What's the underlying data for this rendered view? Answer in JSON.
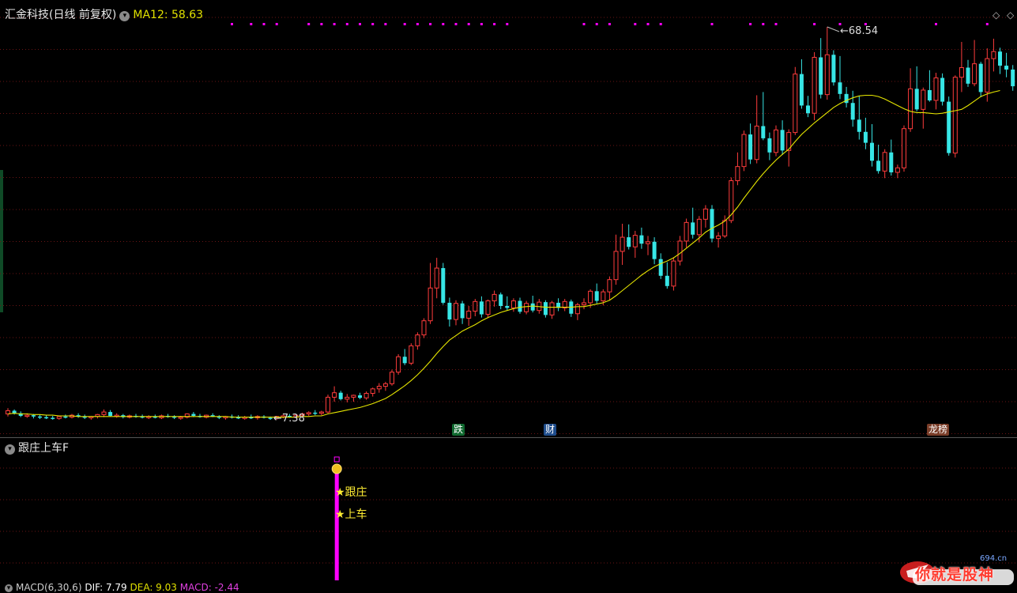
{
  "header": {
    "stock_name": "汇金科技",
    "period_label": "(日线 前复权)",
    "ma_label": "MA12: 58.63"
  },
  "sub_panel": {
    "title": "跟庄上车F"
  },
  "signals": {
    "line1": "★跟庄",
    "line2": "★上车"
  },
  "macd_panel": {
    "params": "MACD(6,30,6)",
    "dif": "DIF: 7.79",
    "dea": "DEA: 9.03",
    "macd": "MACD: -2.44"
  },
  "badges": {
    "die": "跌",
    "cai": "财",
    "bang": "龙榜"
  },
  "price_labels": {
    "high": "68.54",
    "low": "7.38",
    "high_arrow": "←",
    "low_arrow": "←"
  },
  "watermark": {
    "text": "你就是股神",
    "site": "694.cn"
  },
  "colors": {
    "up": "#ff3c3c",
    "down": "#37e6e6",
    "ma": "#e6e600",
    "signal": "#ff00ff",
    "dots": "#ff00ff"
  },
  "chart_data": {
    "type": "candlestick",
    "title": "汇金科技(日线 前复权)",
    "y_min_label": 7.38,
    "y_max_label": 68.54,
    "ylim": [
      0,
      72
    ],
    "grid": true,
    "candles": [
      [
        8.3,
        9.2,
        7.9,
        8.8
      ],
      [
        8.8,
        9.0,
        8.2,
        8.4
      ],
      [
        8.4,
        8.7,
        7.8,
        8.0
      ],
      [
        8.0,
        8.4,
        7.7,
        8.1
      ],
      [
        8.1,
        8.3,
        7.6,
        7.9
      ],
      [
        7.9,
        8.2,
        7.5,
        7.8
      ],
      [
        7.8,
        8.1,
        7.5,
        7.7
      ],
      [
        7.7,
        8.0,
        7.4,
        7.6
      ],
      [
        7.6,
        8.0,
        7.4,
        7.9
      ],
      [
        7.9,
        8.2,
        7.6,
        7.8
      ],
      [
        7.8,
        8.3,
        7.6,
        8.1
      ],
      [
        8.1,
        8.4,
        7.7,
        7.9
      ],
      [
        7.9,
        8.2,
        7.5,
        7.7
      ],
      [
        7.7,
        8.0,
        7.4,
        7.9
      ],
      [
        7.9,
        8.3,
        7.6,
        8.2
      ],
      [
        8.2,
        9.0,
        7.8,
        8.6
      ],
      [
        8.6,
        8.9,
        7.9,
        8.0
      ],
      [
        8.0,
        8.4,
        7.7,
        8.1
      ],
      [
        8.1,
        8.3,
        7.6,
        7.8
      ],
      [
        7.8,
        8.2,
        7.6,
        8.0
      ],
      [
        8.0,
        8.3,
        7.7,
        7.9
      ],
      [
        7.9,
        8.2,
        7.6,
        7.8
      ],
      [
        7.8,
        8.1,
        7.5,
        7.9
      ],
      [
        7.9,
        8.2,
        7.6,
        7.7
      ],
      [
        7.7,
        8.2,
        7.5,
        8.0
      ],
      [
        8.0,
        8.3,
        7.7,
        7.9
      ],
      [
        7.9,
        8.1,
        7.5,
        7.7
      ],
      [
        7.7,
        8.0,
        7.4,
        7.8
      ],
      [
        7.8,
        8.4,
        7.6,
        8.3
      ],
      [
        8.3,
        8.6,
        7.8,
        8.0
      ],
      [
        8.0,
        8.3,
        7.7,
        7.8
      ],
      [
        7.8,
        8.2,
        7.6,
        8.1
      ],
      [
        8.1,
        8.4,
        7.8,
        7.9
      ],
      [
        7.9,
        8.1,
        7.5,
        7.7
      ],
      [
        7.7,
        8.0,
        7.4,
        7.9
      ],
      [
        7.9,
        8.2,
        7.6,
        7.8
      ],
      [
        7.8,
        8.1,
        7.5,
        7.6
      ],
      [
        7.6,
        8.0,
        7.4,
        7.8
      ],
      [
        7.8,
        8.2,
        7.5,
        7.7
      ],
      [
        7.7,
        8.1,
        7.4,
        7.9
      ],
      [
        7.9,
        8.1,
        7.6,
        7.7
      ],
      [
        7.7,
        7.9,
        7.38,
        7.6
      ],
      [
        7.6,
        8.0,
        7.4,
        7.9
      ],
      [
        7.9,
        8.2,
        7.6,
        8.0
      ],
      [
        8.0,
        8.3,
        7.7,
        7.8
      ],
      [
        7.8,
        8.3,
        7.6,
        8.1
      ],
      [
        8.1,
        8.5,
        7.8,
        8.3
      ],
      [
        8.3,
        8.7,
        8.0,
        8.5
      ],
      [
        8.5,
        8.9,
        8.1,
        8.4
      ],
      [
        8.4,
        8.8,
        8.1,
        8.6
      ],
      [
        8.6,
        11.3,
        8.4,
        10.9
      ],
      [
        10.9,
        12.6,
        10.2,
        11.6
      ],
      [
        11.6,
        11.9,
        10.4,
        10.6
      ],
      [
        10.6,
        11.4,
        10.1,
        10.9
      ],
      [
        10.9,
        11.3,
        10.2,
        11.2
      ],
      [
        11.2,
        11.6,
        10.6,
        10.8
      ],
      [
        10.8,
        11.8,
        10.5,
        11.5
      ],
      [
        11.5,
        12.4,
        11.0,
        12.2
      ],
      [
        12.2,
        13.1,
        11.6,
        12.6
      ],
      [
        12.6,
        13.3,
        11.9,
        13.0
      ],
      [
        13.0,
        15.2,
        12.7,
        14.8
      ],
      [
        14.8,
        17.6,
        14.4,
        17.2
      ],
      [
        17.2,
        18.4,
        15.9,
        16.2
      ],
      [
        16.2,
        19.3,
        15.9,
        18.9
      ],
      [
        18.9,
        21.0,
        18.3,
        20.6
      ],
      [
        20.6,
        23.2,
        20.1,
        22.8
      ],
      [
        22.8,
        31.8,
        22.3,
        27.9
      ],
      [
        27.9,
        32.6,
        26.3,
        31.0
      ],
      [
        31.0,
        31.8,
        25.3,
        25.6
      ],
      [
        25.6,
        26.4,
        21.9,
        23.0
      ],
      [
        23.0,
        26.0,
        22.1,
        25.5
      ],
      [
        25.5,
        25.9,
        22.3,
        23.2
      ],
      [
        23.2,
        25.1,
        22.0,
        24.3
      ],
      [
        24.3,
        26.2,
        23.5,
        25.8
      ],
      [
        25.8,
        26.6,
        23.3,
        23.8
      ],
      [
        23.8,
        26.1,
        23.2,
        25.9
      ],
      [
        25.9,
        27.5,
        25.0,
        26.9
      ],
      [
        26.9,
        27.2,
        24.6,
        25.1
      ],
      [
        25.1,
        26.6,
        24.4,
        24.8
      ],
      [
        24.8,
        26.3,
        24.2,
        25.9
      ],
      [
        25.9,
        26.4,
        23.9,
        24.2
      ],
      [
        24.2,
        25.9,
        23.8,
        25.5
      ],
      [
        25.5,
        26.7,
        24.1,
        24.4
      ],
      [
        24.4,
        26.2,
        23.9,
        25.7
      ],
      [
        25.7,
        26.0,
        23.3,
        23.7
      ],
      [
        23.7,
        25.9,
        23.1,
        25.6
      ],
      [
        25.6,
        26.3,
        24.3,
        24.8
      ],
      [
        24.8,
        26.2,
        24.3,
        25.8
      ],
      [
        25.8,
        26.1,
        23.4,
        23.9
      ],
      [
        23.9,
        25.6,
        22.9,
        25.3
      ],
      [
        25.3,
        26.3,
        24.6,
        25.6
      ],
      [
        25.6,
        27.7,
        24.8,
        27.4
      ],
      [
        27.4,
        28.6,
        25.5,
        25.9
      ],
      [
        25.9,
        27.7,
        25.2,
        27.3
      ],
      [
        27.3,
        29.7,
        26.0,
        29.2
      ],
      [
        29.2,
        36.2,
        28.4,
        33.6
      ],
      [
        33.6,
        37.9,
        31.5,
        35.8
      ],
      [
        35.8,
        37.8,
        33.9,
        34.3
      ],
      [
        34.3,
        36.8,
        32.6,
        36.1
      ],
      [
        36.1,
        37.3,
        34.0,
        34.8
      ],
      [
        34.8,
        36.0,
        33.0,
        35.1
      ],
      [
        35.1,
        35.8,
        31.6,
        32.4
      ],
      [
        32.4,
        33.3,
        29.3,
        29.8
      ],
      [
        29.8,
        31.9,
        27.8,
        28.2
      ],
      [
        28.2,
        32.7,
        27.5,
        32.1
      ],
      [
        32.1,
        36.0,
        31.4,
        35.2
      ],
      [
        35.2,
        38.7,
        34.2,
        38.1
      ],
      [
        38.1,
        40.4,
        35.6,
        36.2
      ],
      [
        36.2,
        39.1,
        35.0,
        38.6
      ],
      [
        38.6,
        40.8,
        37.3,
        40.2
      ],
      [
        40.2,
        40.8,
        35.0,
        35.6
      ],
      [
        35.6,
        36.6,
        34.2,
        36.0
      ],
      [
        36.0,
        39.2,
        35.7,
        38.4
      ],
      [
        38.4,
        45.1,
        38.0,
        44.6
      ],
      [
        44.6,
        49.0,
        43.9,
        46.8
      ],
      [
        46.8,
        52.4,
        46.1,
        51.8
      ],
      [
        51.8,
        53.5,
        47.2,
        47.9
      ],
      [
        47.9,
        57.9,
        47.3,
        53.1
      ],
      [
        53.1,
        58.4,
        50.9,
        51.2
      ],
      [
        51.2,
        52.1,
        47.8,
        49.0
      ],
      [
        49.0,
        53.2,
        48.4,
        52.5
      ],
      [
        52.5,
        54.0,
        48.6,
        49.3
      ],
      [
        49.3,
        52.6,
        46.8,
        52.1
      ],
      [
        52.1,
        62.3,
        51.7,
        61.2
      ],
      [
        61.2,
        63.5,
        55.8,
        56.3
      ],
      [
        56.3,
        57.8,
        54.5,
        55.1
      ],
      [
        55.1,
        64.6,
        54.0,
        63.8
      ],
      [
        63.8,
        66.8,
        57.4,
        58.0
      ],
      [
        58.0,
        68.54,
        57.2,
        64.2
      ],
      [
        64.2,
        64.9,
        59.4,
        59.9
      ],
      [
        59.9,
        64.0,
        57.3,
        58.1
      ],
      [
        58.1,
        59.2,
        56.0,
        56.7
      ],
      [
        56.7,
        58.6,
        53.0,
        54.1
      ],
      [
        54.1,
        57.8,
        51.0,
        52.2
      ],
      [
        52.2,
        54.4,
        49.5,
        50.5
      ],
      [
        50.5,
        53.4,
        46.8,
        47.7
      ],
      [
        47.7,
        50.2,
        45.7,
        46.1
      ],
      [
        46.1,
        49.5,
        45.0,
        49.0
      ],
      [
        49.0,
        51.0,
        45.4,
        45.9
      ],
      [
        45.9,
        47.1,
        45.0,
        46.6
      ],
      [
        46.6,
        53.2,
        46.0,
        52.7
      ],
      [
        52.7,
        62.1,
        52.2,
        58.9
      ],
      [
        58.9,
        62.4,
        55.4,
        55.7
      ],
      [
        55.7,
        59.1,
        52.7,
        58.7
      ],
      [
        58.7,
        61.8,
        56.9,
        57.1
      ],
      [
        57.1,
        61.4,
        55.7,
        60.6
      ],
      [
        60.6,
        61.3,
        56.3,
        56.9
      ],
      [
        56.9,
        57.7,
        48.5,
        48.9
      ],
      [
        48.9,
        61.0,
        48.2,
        60.7
      ],
      [
        60.7,
        66.2,
        58.4,
        62.2
      ],
      [
        62.2,
        63.4,
        59.2,
        59.7
      ],
      [
        59.7,
        66.5,
        59.3,
        62.8
      ],
      [
        62.8,
        63.1,
        57.6,
        58.4
      ],
      [
        58.4,
        65.2,
        56.9,
        63.6
      ],
      [
        63.6,
        66.7,
        61.6,
        64.7
      ],
      [
        64.7,
        65.3,
        61.2,
        62.5
      ],
      [
        62.5,
        64.5,
        60.7,
        61.9
      ],
      [
        61.9,
        62.6,
        58.6,
        59.3
      ]
    ],
    "ma12": [
      8.3,
      8.4,
      8.3,
      8.3,
      8.2,
      8.2,
      8.1,
      8.1,
      8.0,
      8.0,
      8.0,
      7.9,
      7.9,
      7.9,
      7.9,
      7.9,
      7.9,
      7.9,
      7.9,
      7.9,
      7.9,
      7.9,
      7.9,
      7.9,
      7.9,
      7.9,
      7.9,
      7.9,
      7.9,
      7.9,
      7.9,
      7.9,
      7.9,
      7.9,
      7.9,
      7.8,
      7.8,
      7.8,
      7.8,
      7.8,
      7.8,
      7.8,
      7.8,
      7.8,
      7.8,
      7.8,
      7.9,
      7.9,
      8.0,
      8.0,
      8.3,
      8.5,
      8.7,
      8.9,
      9.1,
      9.3,
      9.6,
      9.9,
      10.3,
      10.7,
      11.3,
      12.0,
      12.7,
      13.5,
      14.4,
      15.4,
      16.5,
      17.7,
      18.8,
      19.8,
      20.5,
      21.2,
      21.7,
      22.2,
      22.8,
      23.3,
      23.7,
      24.1,
      24.4,
      24.7,
      24.9,
      25.0,
      25.1,
      25.0,
      24.9,
      24.9,
      24.9,
      24.9,
      24.9,
      25.0,
      25.0,
      25.2,
      25.4,
      25.6,
      26.0,
      26.7,
      27.5,
      28.3,
      29.1,
      29.9,
      30.6,
      31.2,
      31.7,
      32.1,
      32.6,
      33.3,
      34.1,
      34.9,
      35.7,
      36.6,
      37.2,
      37.7,
      38.3,
      39.3,
      40.5,
      41.9,
      43.2,
      44.5,
      45.7,
      46.8,
      47.8,
      48.7,
      49.5,
      50.7,
      51.8,
      52.7,
      53.6,
      54.4,
      55.2,
      56.0,
      56.6,
      57.1,
      57.5,
      57.8,
      57.9,
      57.9,
      57.7,
      57.3,
      56.8,
      56.3,
      55.8,
      55.4,
      55.2,
      55.2,
      55.1,
      55.0,
      55.1,
      55.3,
      55.5,
      55.7,
      56.3,
      57.0,
      57.7,
      58.1,
      58.4,
      58.63
    ],
    "signal_bar_index": 42,
    "top_dot_indices": [
      35,
      38,
      40,
      42,
      47,
      49,
      51,
      53,
      55,
      57,
      59,
      62,
      64,
      66,
      68,
      70,
      72,
      74,
      76,
      78,
      90,
      92,
      94,
      98,
      100,
      102,
      110,
      116,
      118,
      120,
      126,
      130,
      134,
      145,
      153
    ]
  }
}
